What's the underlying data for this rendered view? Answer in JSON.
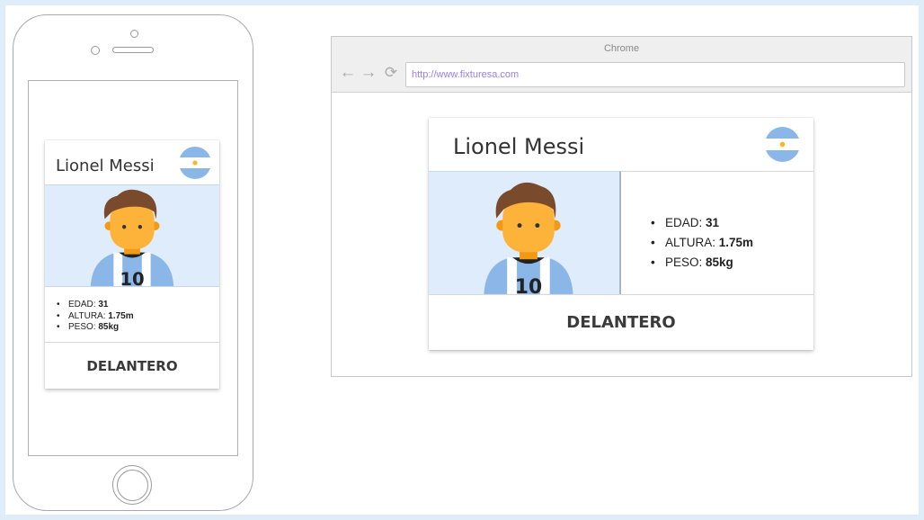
{
  "player": {
    "name": "Lionel Messi",
    "position": "DELANTERO",
    "stats": [
      {
        "label": "EDAD:",
        "value": "31"
      },
      {
        "label": "ALTURA:",
        "value": "1.75m"
      },
      {
        "label": "PESO:",
        "value": "85kg"
      }
    ],
    "jersey_number": "10",
    "flag_icon": "argentina-flag-icon",
    "avatar_icon": "player-avatar-icon"
  },
  "browser": {
    "title": "Chrome",
    "url": "http://www.fixturesa.com",
    "icons": [
      "back-arrow-icon",
      "forward-arrow-icon",
      "reload-icon"
    ]
  },
  "colors": {
    "flag_blue": "#8ab6e8",
    "photo_bg": "#deecfb",
    "skin": "#fdb23a",
    "hair": "#7a4a2c",
    "url_text": "#9b7fdc",
    "frame": "#deedf8"
  }
}
